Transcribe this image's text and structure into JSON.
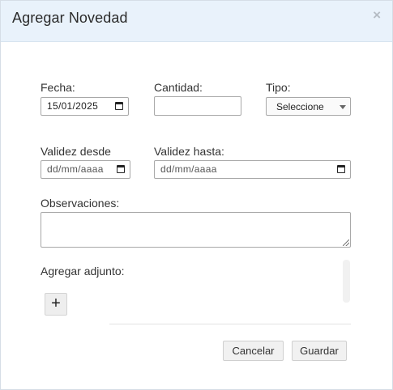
{
  "dialog": {
    "title": "Agregar Novedad",
    "close_glyph": "×"
  },
  "form": {
    "fecha": {
      "label": "Fecha:",
      "value": "15/01/2025",
      "icon": "calendar-icon"
    },
    "cantidad": {
      "label": "Cantidad:",
      "value": ""
    },
    "tipo": {
      "label": "Tipo:",
      "selected": "Seleccione"
    },
    "validez_desde": {
      "label": "Validez desde",
      "placeholder": "dd/mm/aaaa",
      "icon": "calendar-icon"
    },
    "validez_hasta": {
      "label": "Validez hasta:",
      "placeholder": "dd/mm/aaaa",
      "icon": "calendar-icon"
    },
    "observaciones": {
      "label": "Observaciones:",
      "value": ""
    },
    "adjunto": {
      "label": "Agregar adjunto:",
      "add_glyph": "+"
    }
  },
  "footer": {
    "cancel_label": "Cancelar",
    "save_label": "Guardar"
  }
}
